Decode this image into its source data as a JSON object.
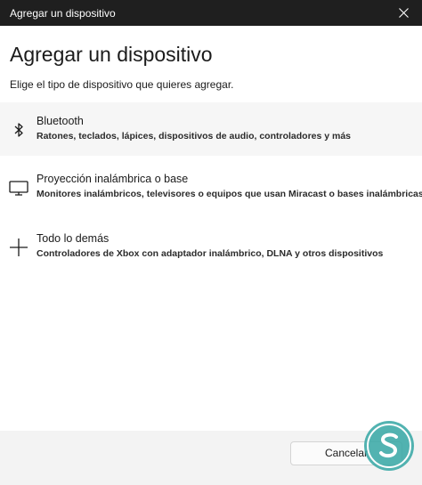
{
  "window": {
    "title": "Agregar un dispositivo",
    "close_icon": "close-icon"
  },
  "main": {
    "heading": "Agregar un dispositivo",
    "subtitle": "Elige el tipo de dispositivo que quieres agregar.",
    "options": [
      {
        "title": "Bluetooth",
        "description": "Ratones, teclados, lápices, dispositivos de audio, controladores y más",
        "icon": "bluetooth-icon"
      },
      {
        "title": "Proyección inalámbrica o base",
        "description": "Monitores inalámbricos, televisores o equipos que usan Miracast o bases inalámbricas",
        "icon": "monitor-icon"
      },
      {
        "title": "Todo lo demás",
        "description": "Controladores de Xbox con adaptador inalámbrico, DLNA y otros dispositivos",
        "icon": "plus-icon"
      }
    ]
  },
  "footer": {
    "cancel_label": "Cancelar"
  },
  "colors": {
    "titlebar": "#1f1f1f",
    "selected_row": "#f6f6f6",
    "footer": "#f3f3f3",
    "watermark_teal": "#3aa8a6"
  }
}
